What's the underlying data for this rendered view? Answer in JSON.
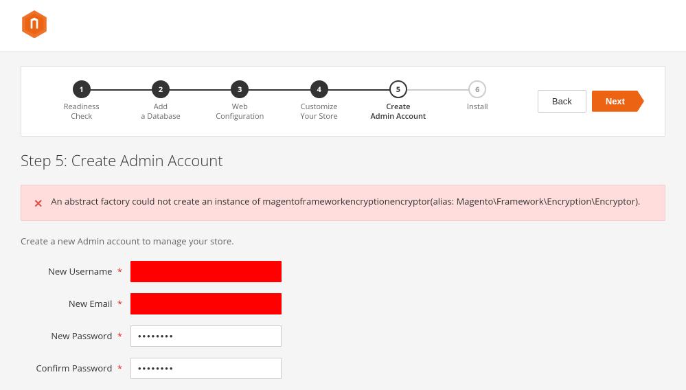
{
  "header": {
    "logo_alt": "Magento Logo"
  },
  "wizard": {
    "steps": [
      {
        "number": "1",
        "label": "Readiness\nCheck",
        "state": "completed"
      },
      {
        "number": "2",
        "label": "Add\na Database",
        "state": "completed"
      },
      {
        "number": "3",
        "label": "Web\nConfiguration",
        "state": "completed"
      },
      {
        "number": "4",
        "label": "Customize\nYour Store",
        "state": "completed"
      },
      {
        "number": "5",
        "label": "Create\nAdmin Account",
        "state": "active"
      },
      {
        "number": "6",
        "label": "Install",
        "state": "inactive"
      }
    ],
    "back_label": "Back",
    "next_label": "Next"
  },
  "page": {
    "step_title": "Step 5: Create Admin Account",
    "error_message": "An abstract factory could not create an instance of magentoframeworkencryptionencryptor(alias: Magento\\Framework\\Encryption\\Encryptor).",
    "form_description": "Create a new Admin account to manage your store.",
    "fields": [
      {
        "label": "New Username",
        "required": true,
        "type": "text",
        "has_error": true,
        "value": ""
      },
      {
        "label": "New Email",
        "required": true,
        "type": "email",
        "has_error": true,
        "value": ""
      },
      {
        "label": "New Password",
        "required": true,
        "type": "password",
        "has_error": false,
        "value": "•••••••"
      },
      {
        "label": "Confirm Password",
        "required": true,
        "type": "password",
        "has_error": false,
        "value": "•••••••"
      }
    ]
  }
}
